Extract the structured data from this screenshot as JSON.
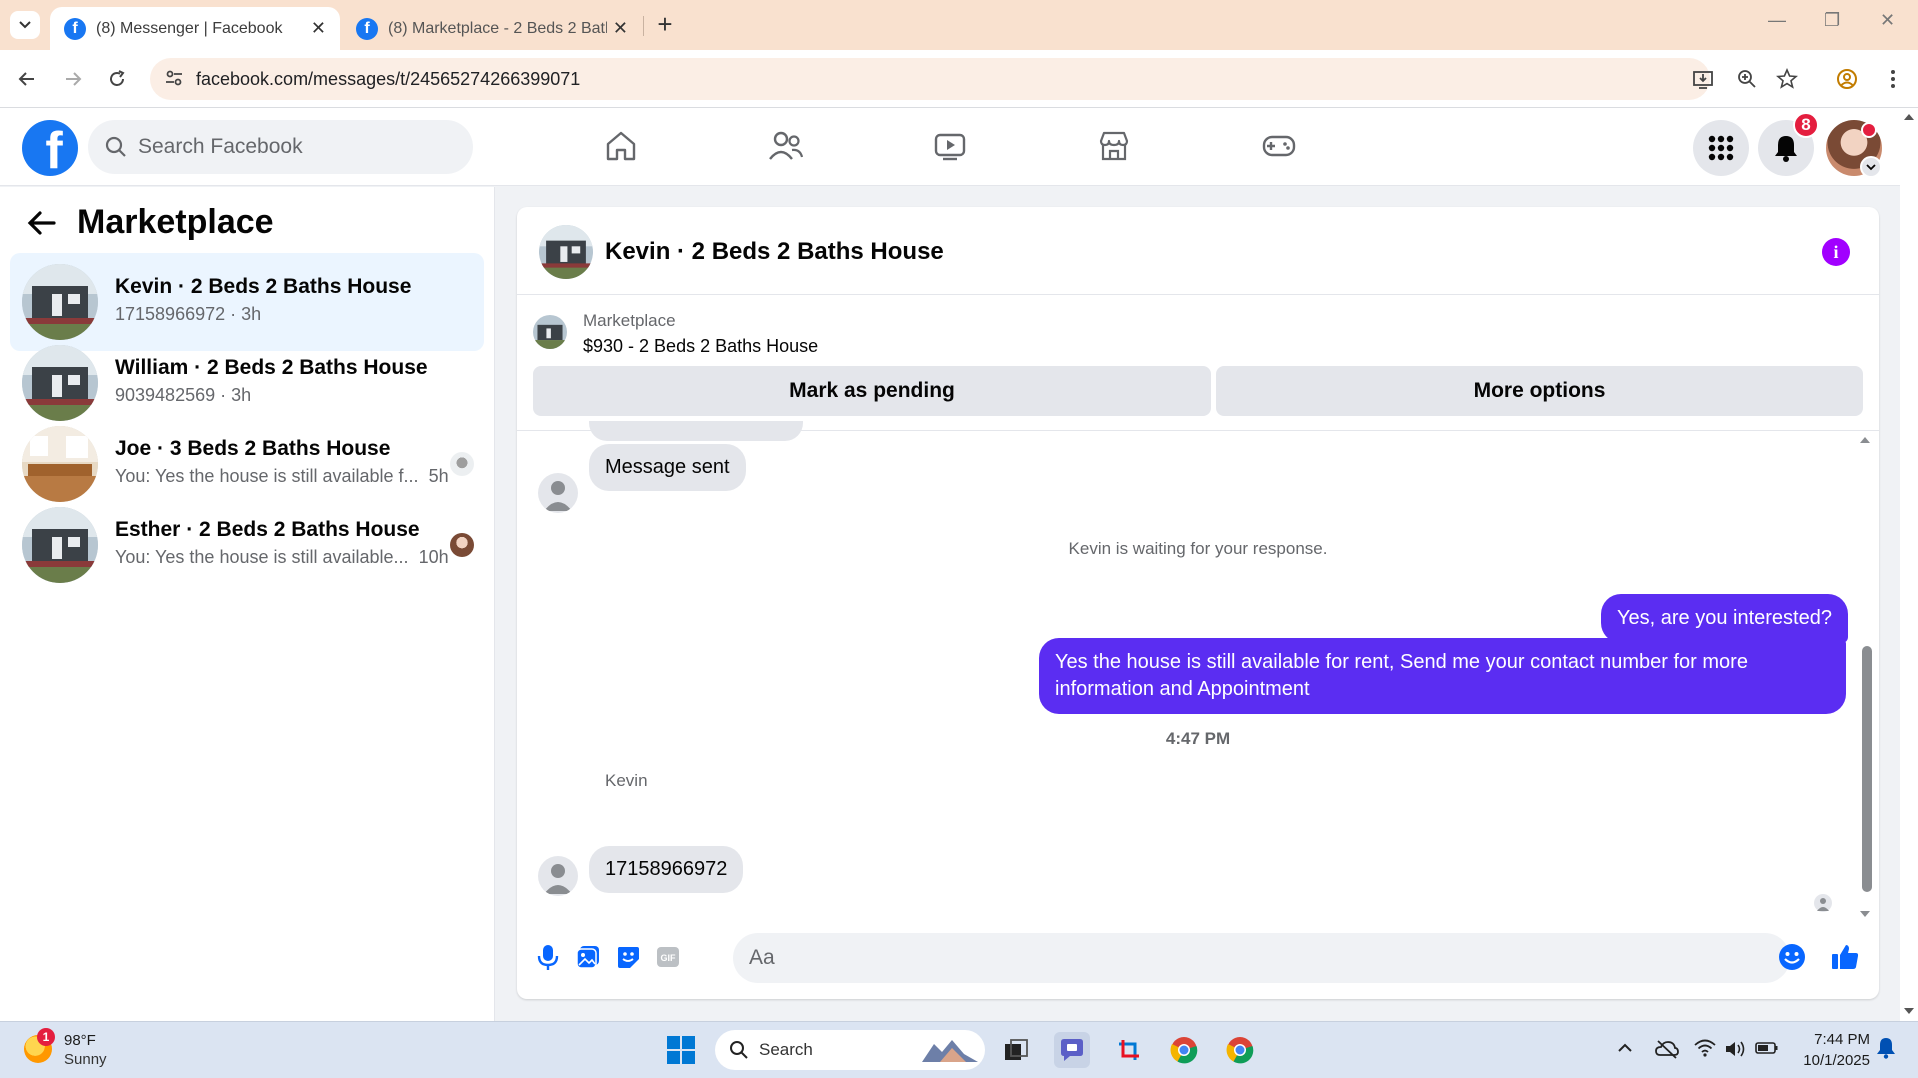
{
  "browser": {
    "tabs": [
      {
        "title": "(8) Messenger | Facebook",
        "active": true
      },
      {
        "title": "(8) Marketplace - 2 Beds 2 Baths House",
        "active": false
      }
    ],
    "url": "facebook.com/messages/t/24565274266399071"
  },
  "fb_header": {
    "logo_letter": "f",
    "search_placeholder": "Search Facebook",
    "notifications_count": "8"
  },
  "left": {
    "title": "Marketplace",
    "conversations": [
      {
        "name": "Kevin · 2 Beds 2 Baths House",
        "preview": "17158966972 · 3h",
        "selected": true
      },
      {
        "name": "William · 2 Beds 2 Baths House",
        "preview": "9039482569 · 3h",
        "selected": false
      },
      {
        "name": "Joe · 3 Beds 2 Baths House",
        "preview": "You: Yes the house is still available f...",
        "time": "5h",
        "selected": false
      },
      {
        "name": "Esther · 2 Beds 2 Baths House",
        "preview": "You: Yes the house is still available...",
        "time": "10h",
        "selected": false
      }
    ]
  },
  "chat": {
    "title": "Kevin · 2 Beds 2 Baths House",
    "info_glyph": "i",
    "listing": {
      "label": "Marketplace",
      "price_title": "$930 - 2 Beds 2 Baths House",
      "btn_pending": "Mark as pending",
      "btn_more": "More options"
    },
    "messages": {
      "in1": "Message sent",
      "system": "Kevin is waiting for your response.",
      "out1": "Yes, are you interested?",
      "out2": "Yes the house is still available for rent, Send me your contact number for more information and Appointment",
      "timestamp": "4:47 PM",
      "sender": "Kevin",
      "in2": "17158966972"
    },
    "composer_placeholder": "Aa"
  },
  "taskbar": {
    "weather_alert": "1",
    "temp": "98°F",
    "condition": "Sunny",
    "search": "Search",
    "time": "7:44 PM",
    "date": "10/1/2025"
  },
  "colors": {
    "fb_blue": "#1877f2",
    "outgoing_bubble": "#5b2df2",
    "info_purple": "#a100ff",
    "badge_red": "#e41e3f"
  }
}
